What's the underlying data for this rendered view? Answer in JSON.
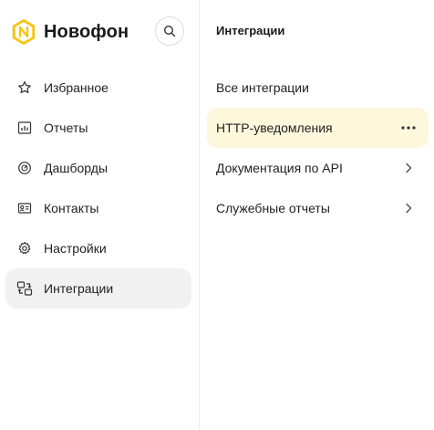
{
  "app": {
    "brand_name": "Новофон",
    "logo_color": "#f5c518",
    "logo_letter": "N"
  },
  "search": {
    "icon": "search-icon"
  },
  "sidebar": {
    "items": [
      {
        "label": "Избранное",
        "icon": "star-icon",
        "active": false
      },
      {
        "label": "Отчеты",
        "icon": "report-chart-icon",
        "active": false
      },
      {
        "label": "Дашборды",
        "icon": "dashboard-gauge-icon",
        "active": false
      },
      {
        "label": "Контакты",
        "icon": "contact-card-icon",
        "active": false
      },
      {
        "label": "Настройки",
        "icon": "gear-icon",
        "active": false
      },
      {
        "label": "Интеграции",
        "icon": "integrations-icon",
        "active": true
      }
    ]
  },
  "main": {
    "title": "Интеграции",
    "items": [
      {
        "label": "Все интеграции",
        "action_icon": "",
        "active": false
      },
      {
        "label": "HTTP-уведомления",
        "action_icon": "more-dots-icon",
        "active": true
      },
      {
        "label": "Документация по API",
        "action_icon": "chevron-right-icon",
        "active": false
      },
      {
        "label": "Служебные отчеты",
        "action_icon": "chevron-right-icon",
        "active": false
      }
    ]
  },
  "colors": {
    "active_nav_bg": "#f1f1f1",
    "active_sub_bg": "#fdf7dc",
    "accent_yellow": "#f5c518"
  }
}
